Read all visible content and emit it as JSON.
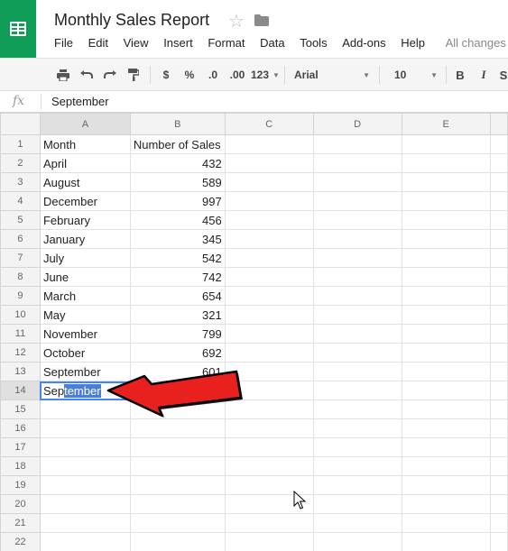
{
  "app": {
    "title": "Monthly Sales Report",
    "menu": [
      "File",
      "Edit",
      "View",
      "Insert",
      "Format",
      "Data",
      "Tools",
      "Add-ons",
      "Help"
    ],
    "save_status": "All changes sa"
  },
  "toolbar": {
    "currency": "$",
    "percent": "%",
    "decrease_decimal": ".0",
    "increase_decimal": ".00",
    "more_formats": "123",
    "font": "Arial",
    "font_size": "10",
    "bold": "B",
    "italic": "I"
  },
  "formula_bar": {
    "icon": "fx",
    "value": "September"
  },
  "columns": [
    "A",
    "B",
    "C",
    "D",
    "E"
  ],
  "rows": [
    {
      "n": "1",
      "a": "Month",
      "b": "Number of Sales"
    },
    {
      "n": "2",
      "a": "April",
      "b": "432"
    },
    {
      "n": "3",
      "a": "August",
      "b": "589"
    },
    {
      "n": "4",
      "a": "December",
      "b": "997"
    },
    {
      "n": "5",
      "a": "February",
      "b": "456"
    },
    {
      "n": "6",
      "a": "January",
      "b": "345"
    },
    {
      "n": "7",
      "a": "July",
      "b": "542"
    },
    {
      "n": "8",
      "a": "June",
      "b": "742"
    },
    {
      "n": "9",
      "a": "March",
      "b": "654"
    },
    {
      "n": "10",
      "a": "May",
      "b": "321"
    },
    {
      "n": "11",
      "a": "November",
      "b": "799"
    },
    {
      "n": "12",
      "a": "October",
      "b": "692"
    },
    {
      "n": "13",
      "a": "September",
      "b": "601"
    },
    {
      "n": "14",
      "a": "",
      "b": ""
    },
    {
      "n": "15",
      "a": "",
      "b": ""
    },
    {
      "n": "16",
      "a": "",
      "b": ""
    },
    {
      "n": "17",
      "a": "",
      "b": ""
    },
    {
      "n": "18",
      "a": "",
      "b": ""
    },
    {
      "n": "19",
      "a": "",
      "b": ""
    },
    {
      "n": "20",
      "a": "",
      "b": ""
    },
    {
      "n": "21",
      "a": "",
      "b": ""
    },
    {
      "n": "22",
      "a": "",
      "b": ""
    }
  ],
  "editing_cell": {
    "typed": "Sep",
    "autocomplete": "tember"
  },
  "colors": {
    "logo": "#0f9d58",
    "selection": "#4285f4",
    "annotation_arrow": "#e8201e"
  }
}
